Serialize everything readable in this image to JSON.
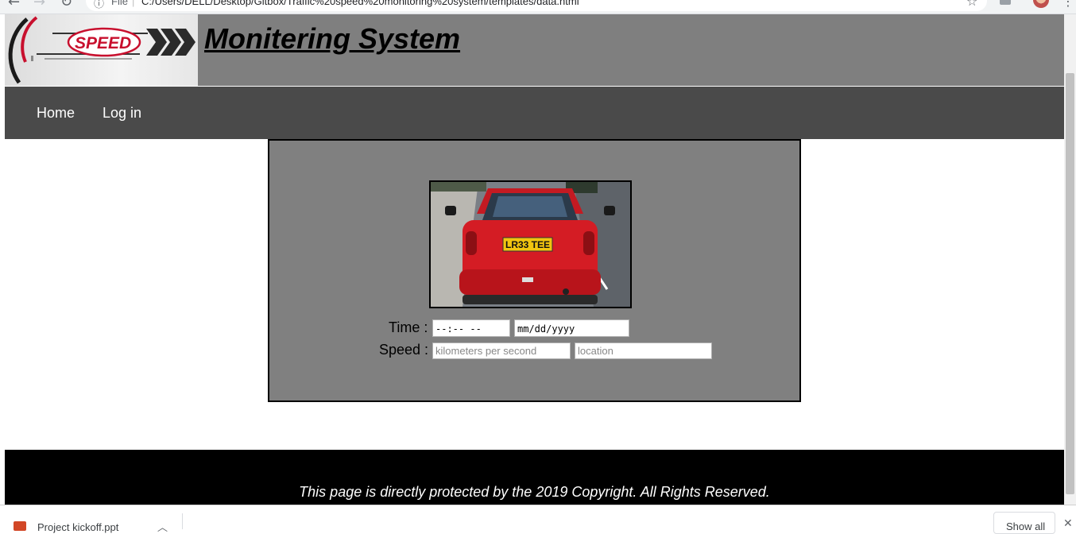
{
  "browser": {
    "back_icon": "arrow-left-icon",
    "forward_icon": "arrow-right-icon",
    "reload_icon": "reload-icon",
    "scheme_label": "File",
    "separator": "|",
    "url": "C:/Users/DELL/Desktop/Gitbox/Traffic%20speed%20monitoring%20system/templates/data.html"
  },
  "header": {
    "logo_text": "SPEED",
    "title": "Monitering System"
  },
  "nav": {
    "items": [
      {
        "label": "Home"
      },
      {
        "label": "Log in"
      }
    ]
  },
  "vehicle": {
    "plate": "LR33 TEE",
    "car_color": "#d41c24"
  },
  "form": {
    "time_label": "Time :",
    "time_value": "--:-- --",
    "date_value": "mm/dd/yyyy",
    "speed_label": "Speed :",
    "speed_placeholder": "kilometers per second",
    "location_placeholder": "location"
  },
  "footer": {
    "text": "This page is directly protected by the 2019 Copyright. All Rights Reserved."
  },
  "downloads": {
    "file_name": "Project kickoff.ppt",
    "show_all_label": "Show all"
  },
  "colors": {
    "header_bg": "#7f7f7f",
    "nav_bg": "#4a4a4a",
    "panel_bg": "#808080",
    "footer_bg": "#000000",
    "logo_red": "#c8102e"
  }
}
